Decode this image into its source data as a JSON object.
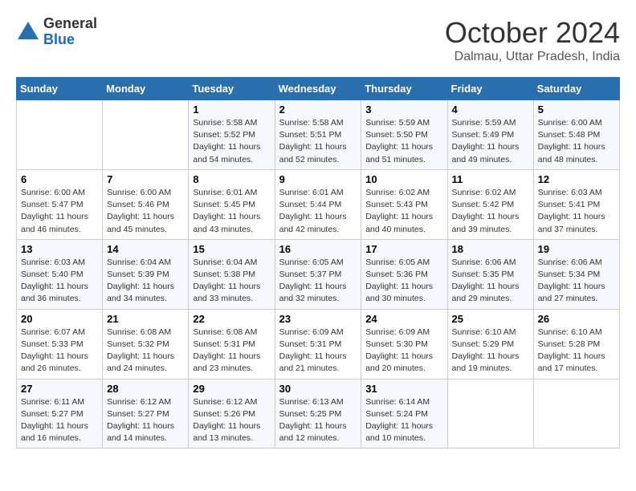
{
  "header": {
    "logo_general": "General",
    "logo_blue": "Blue",
    "month": "October 2024",
    "location": "Dalmau, Uttar Pradesh, India"
  },
  "days_of_week": [
    "Sunday",
    "Monday",
    "Tuesday",
    "Wednesday",
    "Thursday",
    "Friday",
    "Saturday"
  ],
  "weeks": [
    [
      {
        "day": "",
        "sunrise": "",
        "sunset": "",
        "daylight": ""
      },
      {
        "day": "",
        "sunrise": "",
        "sunset": "",
        "daylight": ""
      },
      {
        "day": "1",
        "sunrise": "Sunrise: 5:58 AM",
        "sunset": "Sunset: 5:52 PM",
        "daylight": "Daylight: 11 hours and 54 minutes."
      },
      {
        "day": "2",
        "sunrise": "Sunrise: 5:58 AM",
        "sunset": "Sunset: 5:51 PM",
        "daylight": "Daylight: 11 hours and 52 minutes."
      },
      {
        "day": "3",
        "sunrise": "Sunrise: 5:59 AM",
        "sunset": "Sunset: 5:50 PM",
        "daylight": "Daylight: 11 hours and 51 minutes."
      },
      {
        "day": "4",
        "sunrise": "Sunrise: 5:59 AM",
        "sunset": "Sunset: 5:49 PM",
        "daylight": "Daylight: 11 hours and 49 minutes."
      },
      {
        "day": "5",
        "sunrise": "Sunrise: 6:00 AM",
        "sunset": "Sunset: 5:48 PM",
        "daylight": "Daylight: 11 hours and 48 minutes."
      }
    ],
    [
      {
        "day": "6",
        "sunrise": "Sunrise: 6:00 AM",
        "sunset": "Sunset: 5:47 PM",
        "daylight": "Daylight: 11 hours and 46 minutes."
      },
      {
        "day": "7",
        "sunrise": "Sunrise: 6:00 AM",
        "sunset": "Sunset: 5:46 PM",
        "daylight": "Daylight: 11 hours and 45 minutes."
      },
      {
        "day": "8",
        "sunrise": "Sunrise: 6:01 AM",
        "sunset": "Sunset: 5:45 PM",
        "daylight": "Daylight: 11 hours and 43 minutes."
      },
      {
        "day": "9",
        "sunrise": "Sunrise: 6:01 AM",
        "sunset": "Sunset: 5:44 PM",
        "daylight": "Daylight: 11 hours and 42 minutes."
      },
      {
        "day": "10",
        "sunrise": "Sunrise: 6:02 AM",
        "sunset": "Sunset: 5:43 PM",
        "daylight": "Daylight: 11 hours and 40 minutes."
      },
      {
        "day": "11",
        "sunrise": "Sunrise: 6:02 AM",
        "sunset": "Sunset: 5:42 PM",
        "daylight": "Daylight: 11 hours and 39 minutes."
      },
      {
        "day": "12",
        "sunrise": "Sunrise: 6:03 AM",
        "sunset": "Sunset: 5:41 PM",
        "daylight": "Daylight: 11 hours and 37 minutes."
      }
    ],
    [
      {
        "day": "13",
        "sunrise": "Sunrise: 6:03 AM",
        "sunset": "Sunset: 5:40 PM",
        "daylight": "Daylight: 11 hours and 36 minutes."
      },
      {
        "day": "14",
        "sunrise": "Sunrise: 6:04 AM",
        "sunset": "Sunset: 5:39 PM",
        "daylight": "Daylight: 11 hours and 34 minutes."
      },
      {
        "day": "15",
        "sunrise": "Sunrise: 6:04 AM",
        "sunset": "Sunset: 5:38 PM",
        "daylight": "Daylight: 11 hours and 33 minutes."
      },
      {
        "day": "16",
        "sunrise": "Sunrise: 6:05 AM",
        "sunset": "Sunset: 5:37 PM",
        "daylight": "Daylight: 11 hours and 32 minutes."
      },
      {
        "day": "17",
        "sunrise": "Sunrise: 6:05 AM",
        "sunset": "Sunset: 5:36 PM",
        "daylight": "Daylight: 11 hours and 30 minutes."
      },
      {
        "day": "18",
        "sunrise": "Sunrise: 6:06 AM",
        "sunset": "Sunset: 5:35 PM",
        "daylight": "Daylight: 11 hours and 29 minutes."
      },
      {
        "day": "19",
        "sunrise": "Sunrise: 6:06 AM",
        "sunset": "Sunset: 5:34 PM",
        "daylight": "Daylight: 11 hours and 27 minutes."
      }
    ],
    [
      {
        "day": "20",
        "sunrise": "Sunrise: 6:07 AM",
        "sunset": "Sunset: 5:33 PM",
        "daylight": "Daylight: 11 hours and 26 minutes."
      },
      {
        "day": "21",
        "sunrise": "Sunrise: 6:08 AM",
        "sunset": "Sunset: 5:32 PM",
        "daylight": "Daylight: 11 hours and 24 minutes."
      },
      {
        "day": "22",
        "sunrise": "Sunrise: 6:08 AM",
        "sunset": "Sunset: 5:31 PM",
        "daylight": "Daylight: 11 hours and 23 minutes."
      },
      {
        "day": "23",
        "sunrise": "Sunrise: 6:09 AM",
        "sunset": "Sunset: 5:31 PM",
        "daylight": "Daylight: 11 hours and 21 minutes."
      },
      {
        "day": "24",
        "sunrise": "Sunrise: 6:09 AM",
        "sunset": "Sunset: 5:30 PM",
        "daylight": "Daylight: 11 hours and 20 minutes."
      },
      {
        "day": "25",
        "sunrise": "Sunrise: 6:10 AM",
        "sunset": "Sunset: 5:29 PM",
        "daylight": "Daylight: 11 hours and 19 minutes."
      },
      {
        "day": "26",
        "sunrise": "Sunrise: 6:10 AM",
        "sunset": "Sunset: 5:28 PM",
        "daylight": "Daylight: 11 hours and 17 minutes."
      }
    ],
    [
      {
        "day": "27",
        "sunrise": "Sunrise: 6:11 AM",
        "sunset": "Sunset: 5:27 PM",
        "daylight": "Daylight: 11 hours and 16 minutes."
      },
      {
        "day": "28",
        "sunrise": "Sunrise: 6:12 AM",
        "sunset": "Sunset: 5:27 PM",
        "daylight": "Daylight: 11 hours and 14 minutes."
      },
      {
        "day": "29",
        "sunrise": "Sunrise: 6:12 AM",
        "sunset": "Sunset: 5:26 PM",
        "daylight": "Daylight: 11 hours and 13 minutes."
      },
      {
        "day": "30",
        "sunrise": "Sunrise: 6:13 AM",
        "sunset": "Sunset: 5:25 PM",
        "daylight": "Daylight: 11 hours and 12 minutes."
      },
      {
        "day": "31",
        "sunrise": "Sunrise: 6:14 AM",
        "sunset": "Sunset: 5:24 PM",
        "daylight": "Daylight: 11 hours and 10 minutes."
      },
      {
        "day": "",
        "sunrise": "",
        "sunset": "",
        "daylight": ""
      },
      {
        "day": "",
        "sunrise": "",
        "sunset": "",
        "daylight": ""
      }
    ]
  ]
}
